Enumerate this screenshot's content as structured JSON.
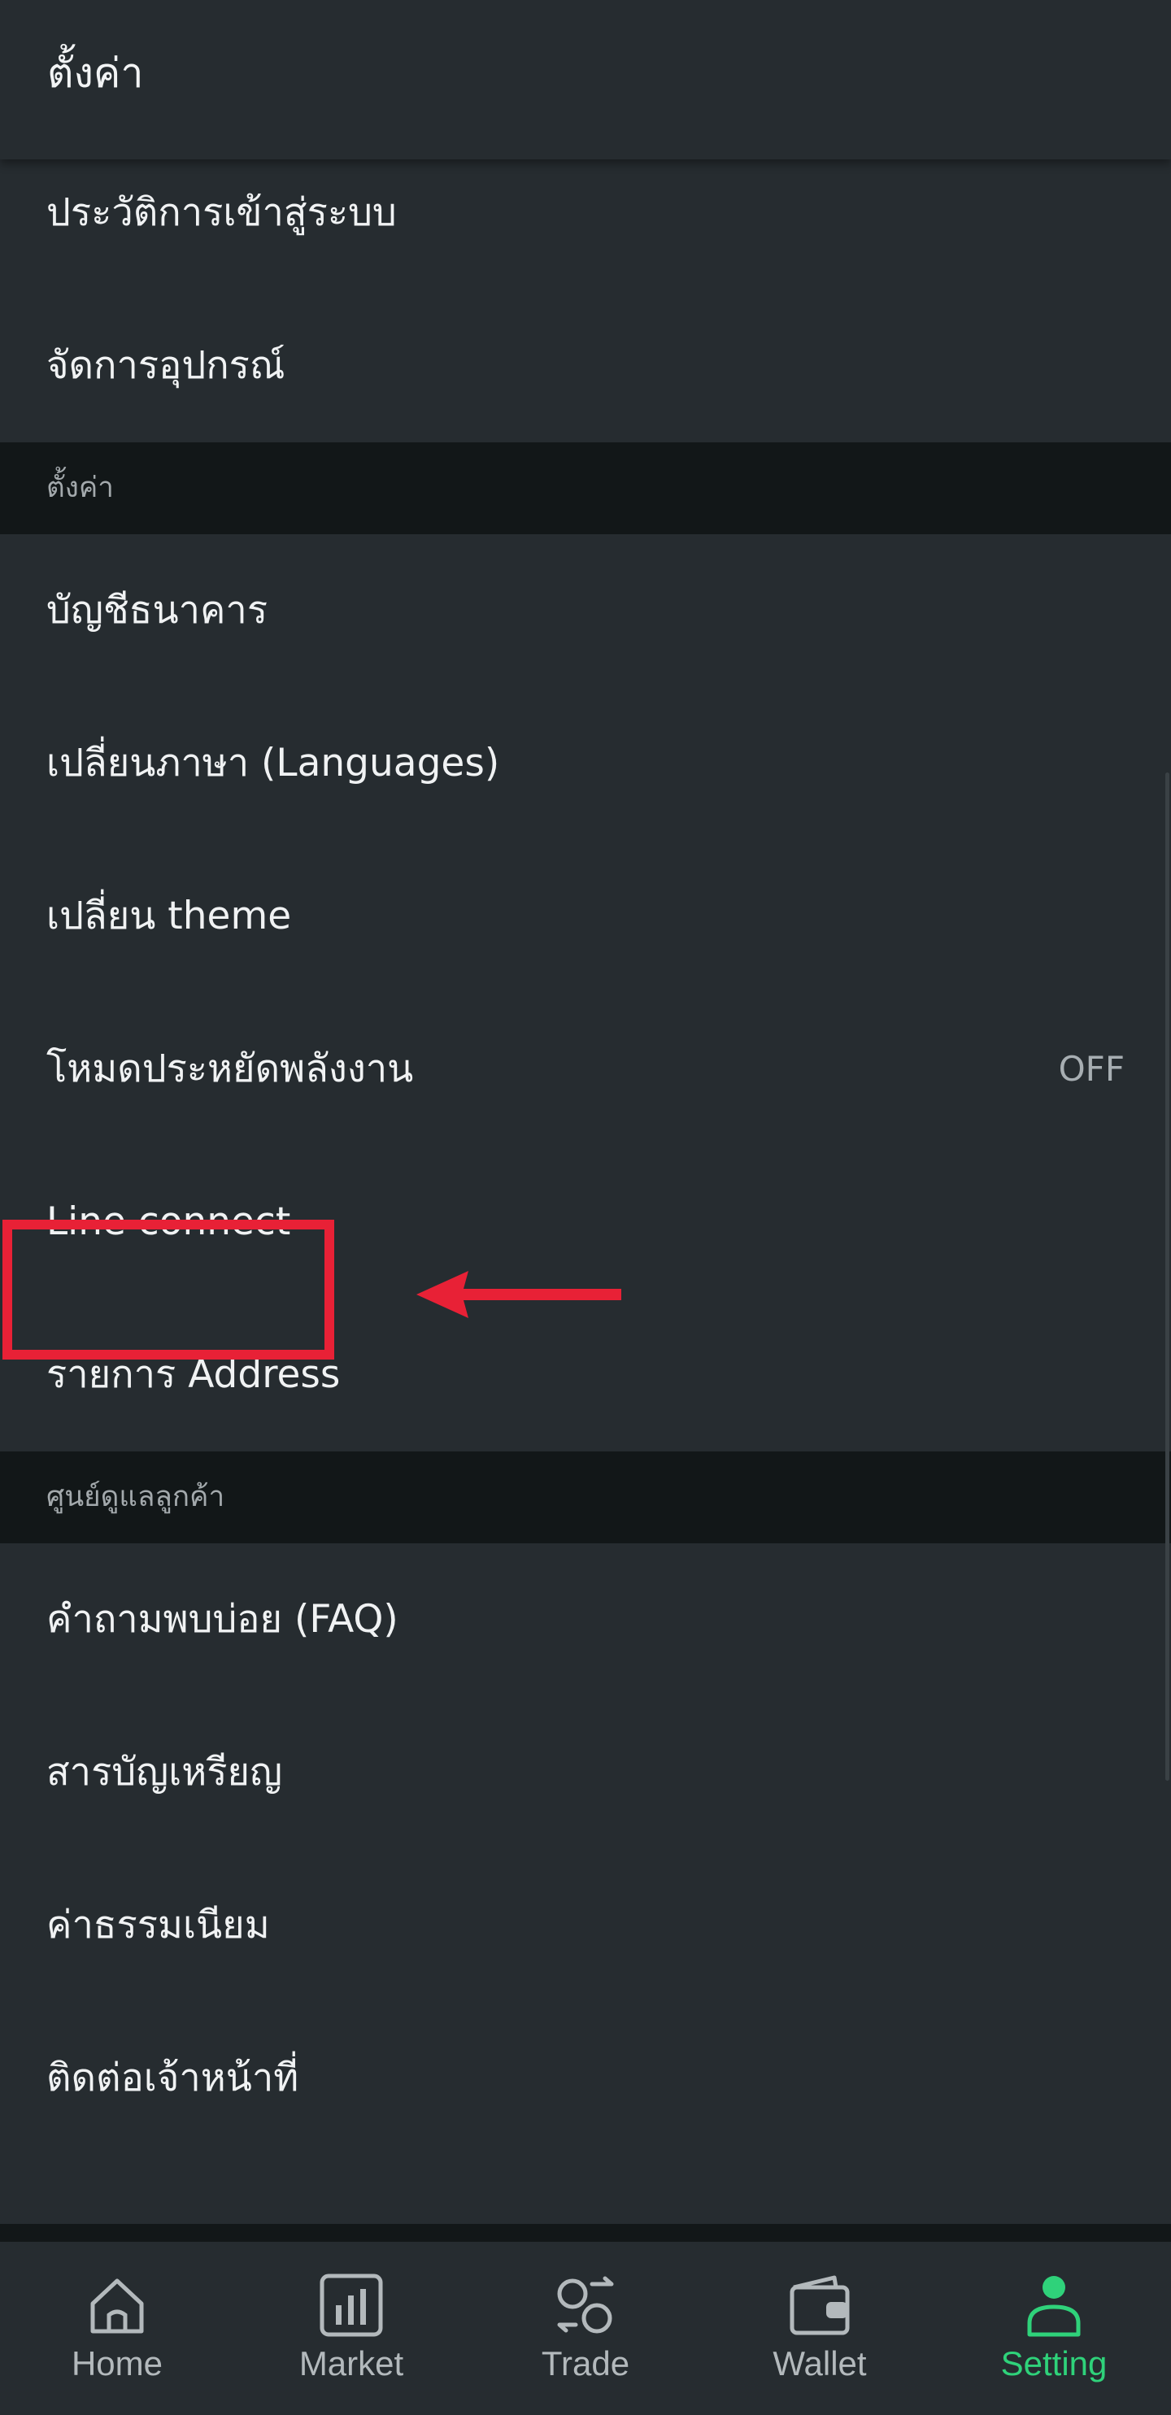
{
  "header": {
    "title": "ตั้งค่า"
  },
  "groups": [
    {
      "items": [
        {
          "label": "ประวัติการเข้าสู่ระบบ"
        },
        {
          "label": "จัดการอุปกรณ์"
        }
      ]
    },
    {
      "section": "ตั้งค่า",
      "items": [
        {
          "label": "บัญชีธนาคาร"
        },
        {
          "label": "เปลี่ยนภาษา (Languages)"
        },
        {
          "label": "เปลี่ยน theme"
        },
        {
          "label": "โหมดประหยัดพลังงาน",
          "value": "OFF"
        },
        {
          "label": "Line connect"
        },
        {
          "label": "รายการ Address"
        }
      ]
    },
    {
      "section": "ศูนย์ดูแลลูกค้า",
      "items": [
        {
          "label": "คำถามพบบ่อย (FAQ)"
        },
        {
          "label": "สารบัญเหรียญ"
        },
        {
          "label": "ค่าธรรมเนียม"
        },
        {
          "label": "ติดต่อเจ้าหน้าที่"
        }
      ]
    }
  ],
  "nav": {
    "items": [
      {
        "label": "Home",
        "icon": "home-icon"
      },
      {
        "label": "Market",
        "icon": "market-chart-icon"
      },
      {
        "label": "Trade",
        "icon": "trade-exchange-icon"
      },
      {
        "label": "Wallet",
        "icon": "wallet-icon"
      },
      {
        "label": "Setting",
        "icon": "user-profile-icon"
      }
    ],
    "active": "Setting"
  },
  "colors": {
    "background": "#262c30",
    "section_background": "#121718",
    "accent": "#2fd27a",
    "annotation": "#e82136"
  }
}
